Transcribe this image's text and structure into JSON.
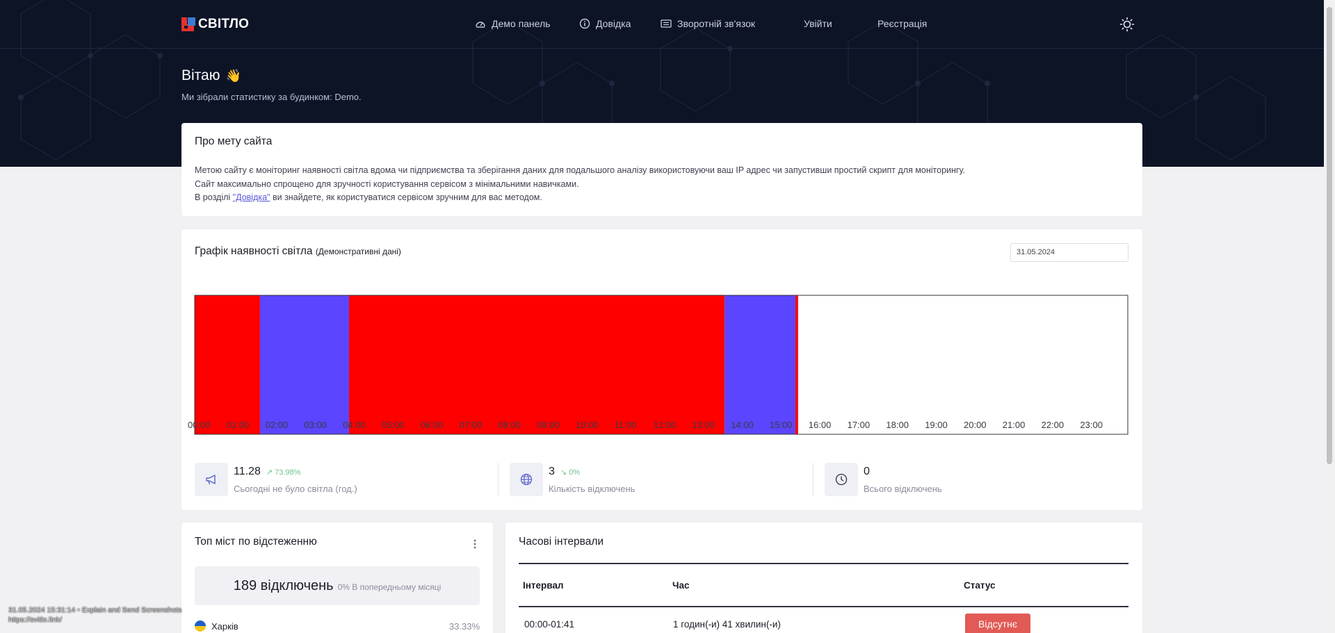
{
  "brand": {
    "name": "СВІТЛО"
  },
  "nav": [
    {
      "label": "Демо панель",
      "icon": "gauge-icon"
    },
    {
      "label": "Довідка",
      "icon": "info-icon"
    },
    {
      "label": "Зворотній зв'язок",
      "icon": "feedback-icon"
    },
    {
      "label": "Увійти"
    },
    {
      "label": "Реєстрація"
    }
  ],
  "greeting": {
    "title": "Вітаю",
    "emoji": "👋",
    "subtitle": "Ми зібрали статистику за будинком: Demo."
  },
  "about": {
    "title": "Про мету сайта",
    "line1": "Метою сайту є моніторинг наявності світла вдома чи підприємства та зберігання даних для подальшого аналізу використовуючи ваш IP адрес чи запустивши простий скрипт для моніторингу.",
    "line2": "Сайт максимально спрощено для зручності користування сервісом з мінімальними навичками.",
    "line3_before": "В розділі ",
    "line3_link": "\"Довідка\"",
    "line3_after": " ви знайдете, як користуватися сервісом зручним для вас методом."
  },
  "schedule": {
    "title": "Графік наявності світла",
    "note": "(Демонстративні дані)",
    "date": "31.05.2024"
  },
  "chart_data": {
    "type": "bar",
    "orientation": "horizontal-timeline",
    "x_unit": "hours",
    "xlim": [
      0,
      24
    ],
    "tick_labels": [
      "00:00",
      "01:00",
      "02:00",
      "03:00",
      "04:00",
      "05:00",
      "06:00",
      "07:00",
      "08:00",
      "09:00",
      "10:00",
      "11:00",
      "12:00",
      "13:00",
      "14:00",
      "15:00",
      "16:00",
      "17:00",
      "18:00",
      "19:00",
      "20:00",
      "21:00",
      "22:00",
      "23:00"
    ],
    "segments": [
      {
        "start": 0.0,
        "end": 1.68,
        "color": "#ff0000"
      },
      {
        "start": 1.68,
        "end": 3.97,
        "color": "#5b45ff"
      },
      {
        "start": 3.97,
        "end": 13.63,
        "color": "#ff0000"
      },
      {
        "start": 13.63,
        "end": 15.45,
        "color": "#5b45ff"
      },
      {
        "start": 15.45,
        "end": 15.52,
        "color": "#ff0000"
      }
    ]
  },
  "stats": [
    {
      "value": "11.28",
      "trend": "73.98%",
      "label": "Сьогодні не було світла (год.)",
      "icon": "megaphone-icon"
    },
    {
      "value": "3",
      "trend": "0%",
      "label": "Кількість відключень",
      "icon": "globe-icon"
    },
    {
      "value": "0",
      "trend": "",
      "label": "Всього відключень",
      "icon": "clock-icon"
    }
  ],
  "top_cities": {
    "title": "Топ міст по відстеженню",
    "total": "189 відключень",
    "total_sub": "0% В попередньому місяці",
    "rows": [
      {
        "city": "Харків",
        "percent": "33.33%"
      }
    ]
  },
  "intervals": {
    "title": "Часові інтервали",
    "headers": {
      "interval": "Інтервал",
      "time": "Час",
      "status": "Статус"
    },
    "rows": [
      {
        "interval": "00:00-01:41",
        "time": "1 годин(-и) 41 хвилин(-и)",
        "status": "Відсутнє"
      }
    ]
  },
  "overlay": {
    "line1": "31.05.2024 15:31:14 • Explain and Send Screenshots",
    "line2": "https://svitlo.link/"
  },
  "colors": {
    "hero": "#0d1426",
    "off": "#ff0000",
    "on": "#5b45ff",
    "status_off": "#e15a55",
    "link": "#5a56d6"
  }
}
